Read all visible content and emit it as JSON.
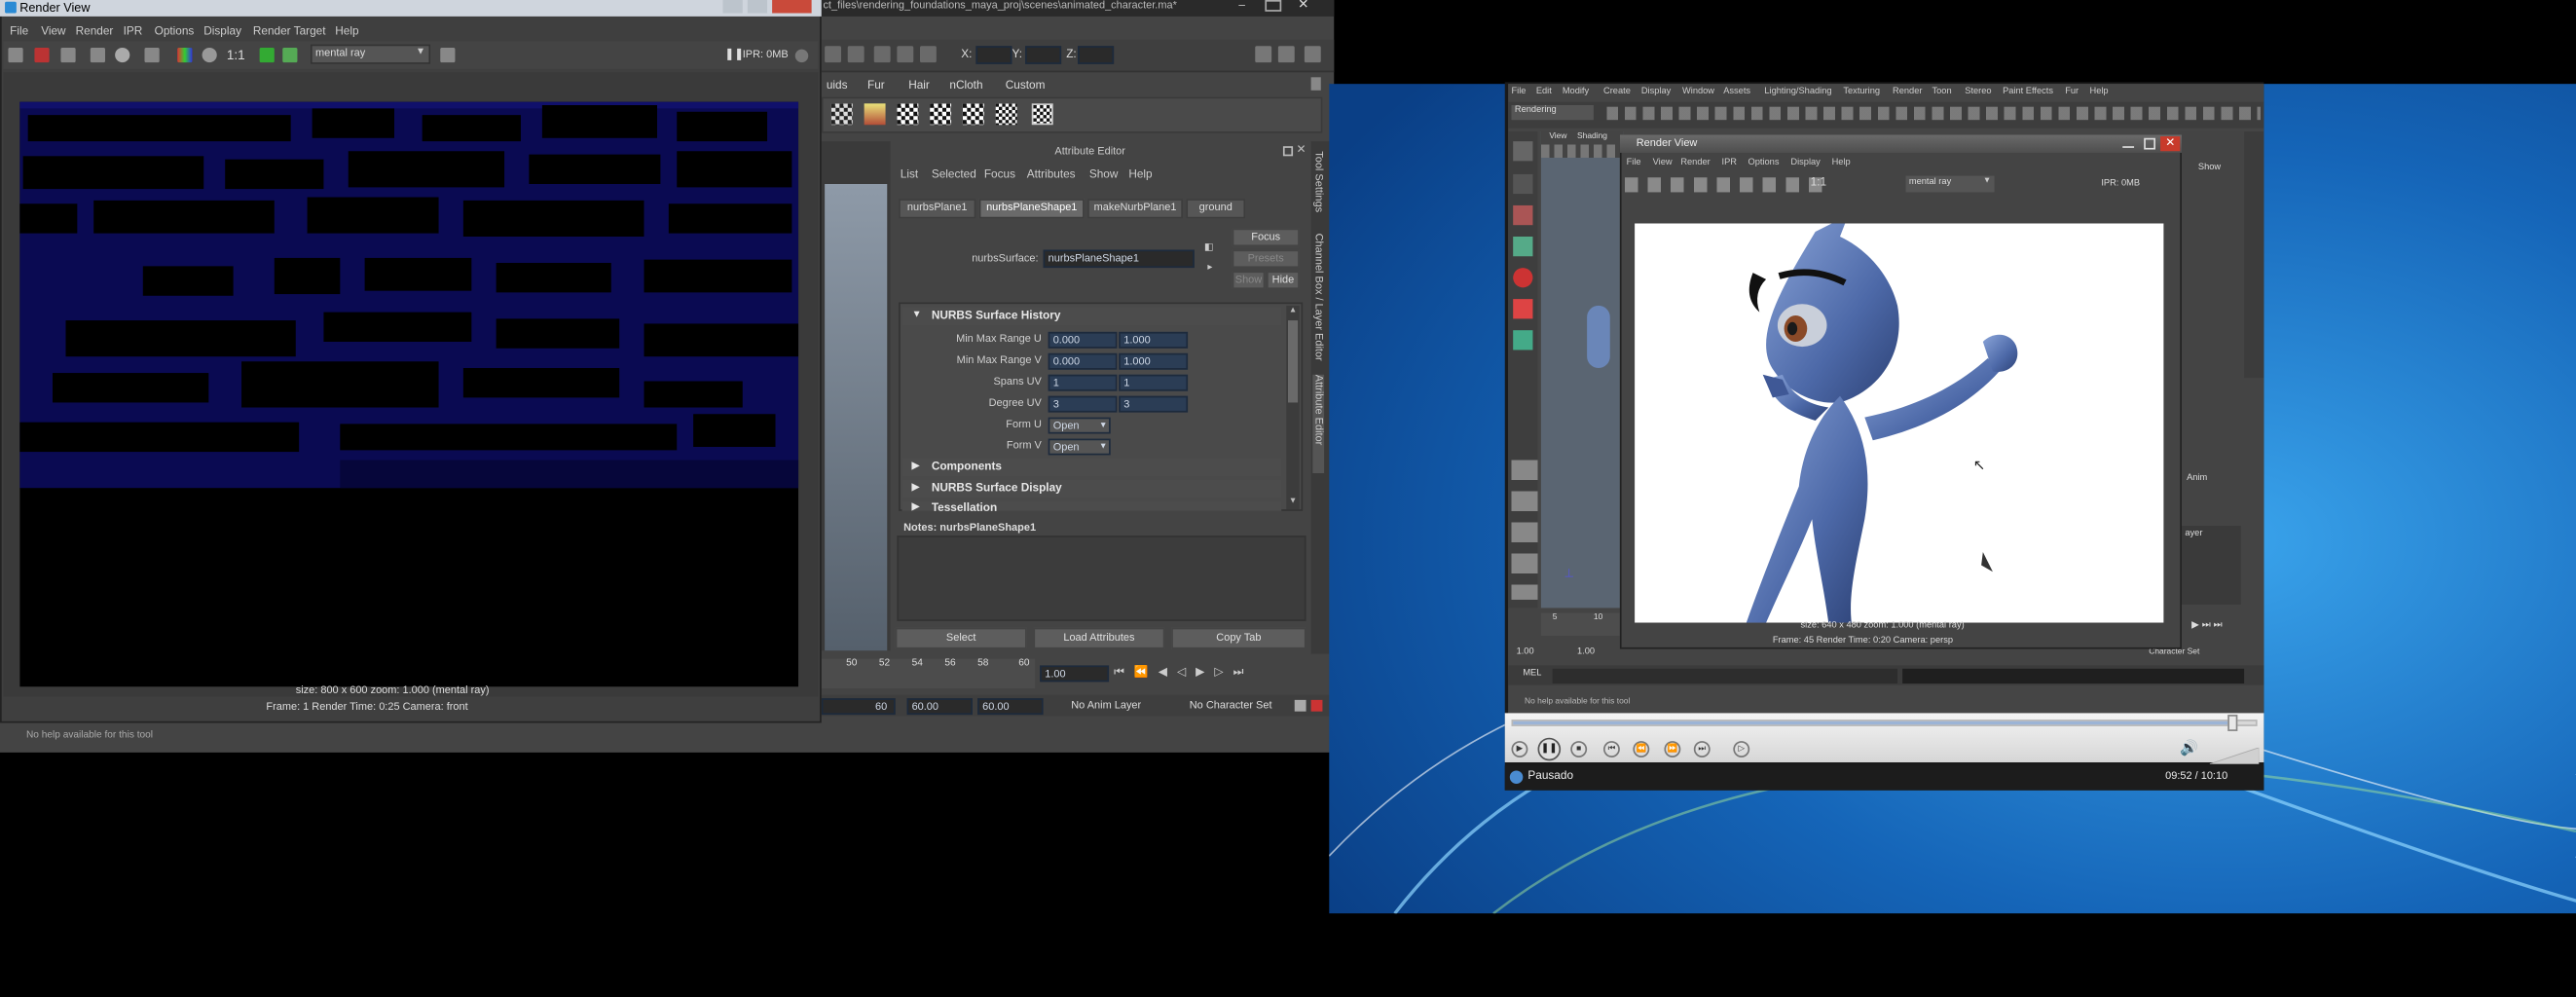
{
  "left_maya": {
    "title_path": "ct_files\\rendering_foundations_maya_proj\\scenes\\animated_character.ma*",
    "coord_labels": [
      "X:",
      "Y:",
      "Z:"
    ],
    "shelf_tabs": [
      "uids",
      "Fur",
      "Hair",
      "nCloth",
      "Custom"
    ],
    "status_line": "No help available for this tool"
  },
  "render_view_left": {
    "title": "Render View",
    "menu": [
      "File",
      "View",
      "Render",
      "IPR",
      "Options",
      "Display",
      "Render Target",
      "Help"
    ],
    "ratio_label": "1:1",
    "renderer": "mental ray",
    "ipr_label": "IPR: 0MB",
    "info_line1": "size: 800 x 600 zoom: 1.000      (mental ray)",
    "info_line2": "Frame: 1      Render Time: 0:25      Camera: front"
  },
  "attribute_editor": {
    "header": "Attribute Editor",
    "menu": [
      "List",
      "Selected",
      "Focus",
      "Attributes",
      "Show",
      "Help"
    ],
    "tabs": [
      "nurbsPlane1",
      "nurbsPlaneShape1",
      "makeNurbPlane1",
      "ground"
    ],
    "type_label": "nurbsSurface:",
    "node_name": "nurbsPlaneShape1",
    "focus_btn": "Focus",
    "presets_btn": "Presets",
    "show_btn": "Show",
    "hide_btn": "Hide",
    "sections": {
      "history": "NURBS Surface History",
      "components": "Components",
      "display": "NURBS Surface Display",
      "tessellation": "Tessellation"
    },
    "rows": {
      "min_max_u": {
        "label": "Min Max Range U",
        "a": "0.000",
        "b": "1.000"
      },
      "min_max_v": {
        "label": "Min Max Range V",
        "a": "0.000",
        "b": "1.000"
      },
      "spans": {
        "label": "Spans UV",
        "a": "1",
        "b": "1"
      },
      "degree": {
        "label": "Degree UV",
        "a": "3",
        "b": "3"
      },
      "form_u": {
        "label": "Form U",
        "value": "Open"
      },
      "form_v": {
        "label": "Form V",
        "value": "Open"
      }
    },
    "notes_label": "Notes:  nurbsPlaneShape1",
    "buttons": [
      "Select",
      "Load Attributes",
      "Copy Tab"
    ],
    "side_tabs": [
      "Tool Settings",
      "Channel Box / Layer Editor",
      "Attribute Editor"
    ]
  },
  "timeline": {
    "ticks": [
      "50",
      "52",
      "54",
      "56",
      "58",
      "60"
    ],
    "current_frame": "1.00",
    "range_end": "60",
    "start": "60.00",
    "end": "60.00",
    "anim_layer": "No Anim Layer",
    "char_set": "No Character Set"
  },
  "player": {
    "status": "Pausado",
    "time": "09:52 / 10:10"
  },
  "video_maya": {
    "menu": [
      "File",
      "Edit",
      "Modify",
      "Create",
      "Display",
      "Window",
      "Assets",
      "Lighting/Shading",
      "Texturing",
      "Render",
      "Toon",
      "Stereo",
      "Paint Effects",
      "Fur",
      "Help"
    ],
    "mode": "Rendering",
    "panel_menu": [
      "View",
      "Shading"
    ],
    "render_view_title": "Render View",
    "render_view_menu": [
      "File",
      "View",
      "Render",
      "IPR",
      "Options",
      "Display",
      "Help"
    ],
    "ratio_label": "1:1",
    "renderer": "mental ray",
    "ipr_label": "IPR: 0MB",
    "info_line1": "size: 640 x 480 zoom: 1.000      (mental ray)",
    "info_line2": "Frame: 45      Render Time: 0:20      Camera: persp",
    "side_labels": [
      "Show",
      "Anim",
      "ayer"
    ],
    "ruler": [
      "5",
      "10"
    ],
    "range_a": "1.00",
    "range_b": "1.00",
    "mel": "MEL",
    "help": "No help available for this tool",
    "char_set_short": "Character Set"
  },
  "colors": {
    "maya_bg": "#444444",
    "render_blue": "#0a0a52",
    "desktop_blue": "#1565b8",
    "field_blue": "#2b3d55"
  }
}
